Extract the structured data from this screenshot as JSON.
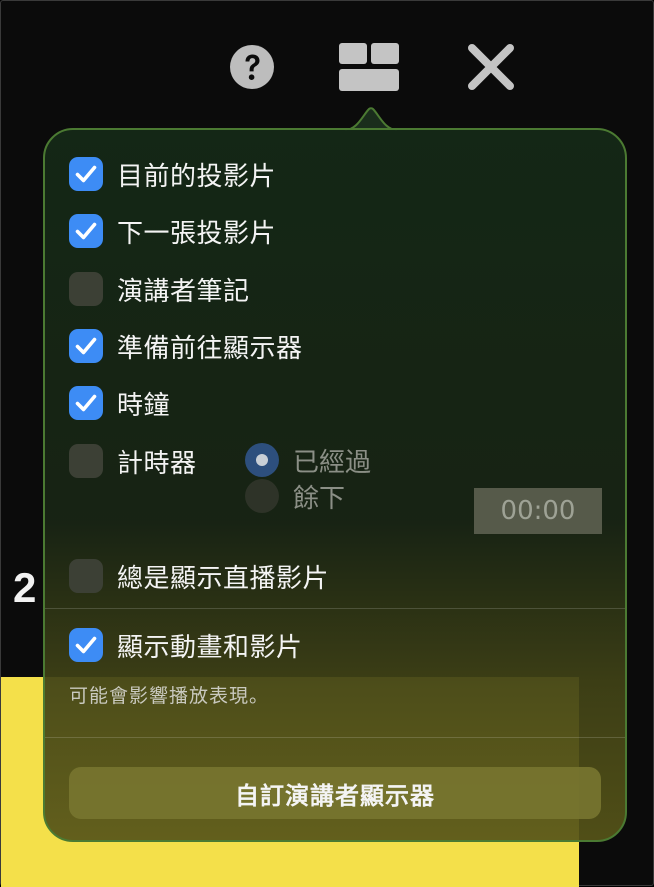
{
  "background": {
    "slide_number": "2"
  },
  "toolbar": {
    "help_icon": "question-circle-icon",
    "layout_icon": "layout-grid-icon",
    "close_icon": "close-x-icon"
  },
  "options": {
    "current_slide": {
      "label": "目前的投影片",
      "checked": true
    },
    "next_slide": {
      "label": "下一張投影片",
      "checked": true
    },
    "presenter_notes": {
      "label": "演講者筆記",
      "checked": false
    },
    "ready_to_advance": {
      "label": "準備前往顯示器",
      "checked": true
    },
    "clock": {
      "label": "時鐘",
      "checked": true
    },
    "timer": {
      "label": "計時器",
      "checked": false
    },
    "always_show_live_video": {
      "label": "總是顯示直播影片",
      "checked": false
    },
    "show_animations": {
      "label": "顯示動畫和影片",
      "checked": true
    }
  },
  "timer_mode": {
    "elapsed_label": "已經過",
    "remaining_label": "餘下",
    "selected": "elapsed",
    "value": "00:00"
  },
  "note": "可能會影響播放表現。",
  "customize_button": "自訂演講者顯示器",
  "colors": {
    "checkbox_on": "#3d8cf5",
    "popover_border": "#4b7a32",
    "yellow_slide": "#f4e04a"
  }
}
